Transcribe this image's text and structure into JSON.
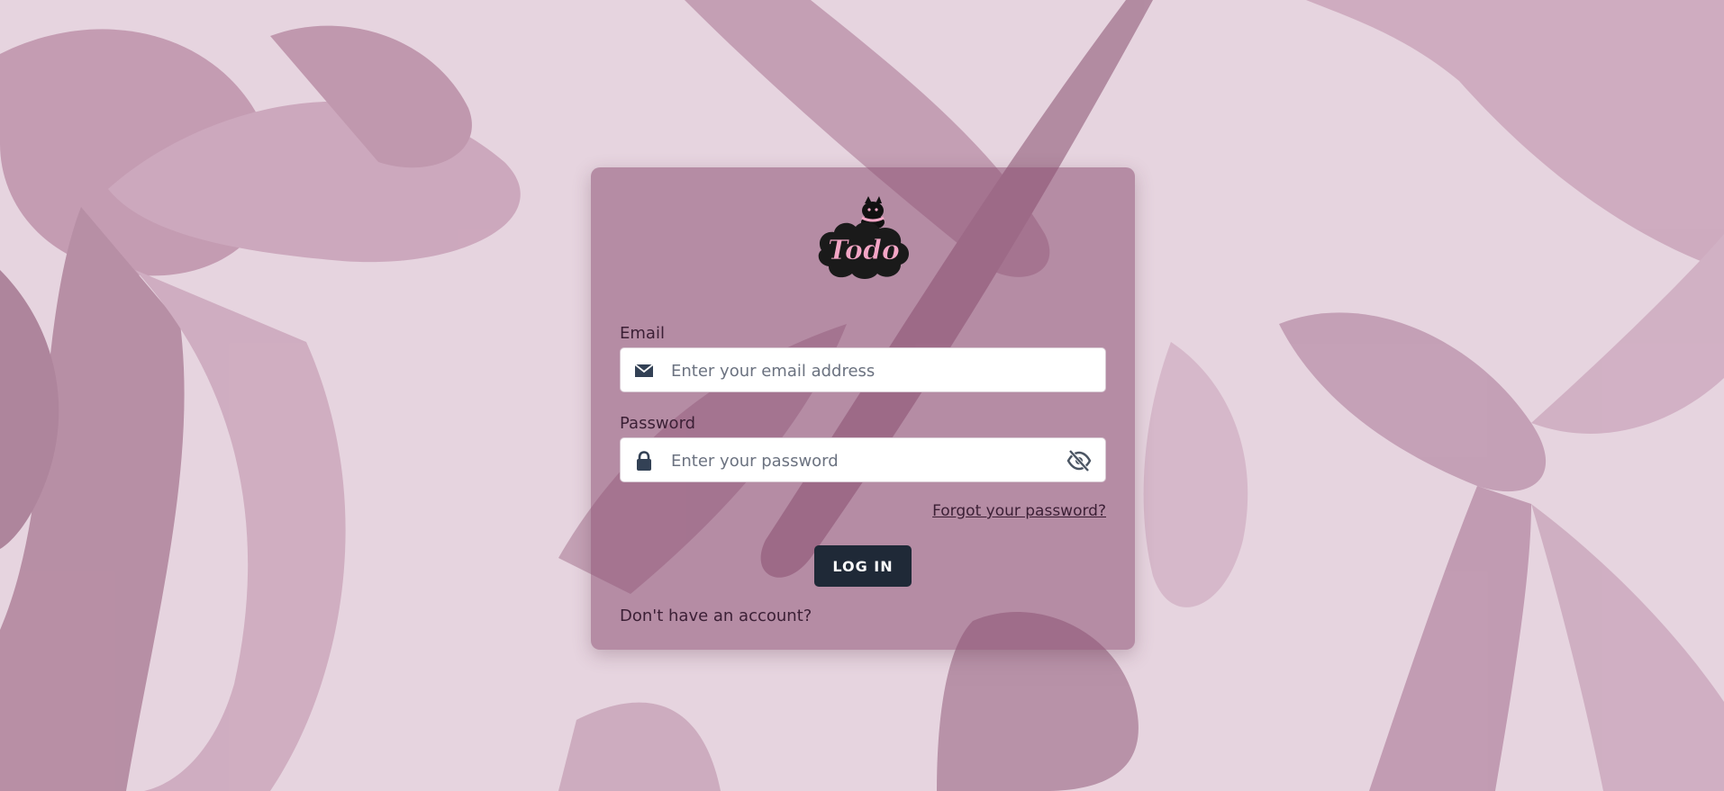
{
  "app": {
    "logo_text": "Todo"
  },
  "form": {
    "email_label": "Email",
    "email_placeholder": "Enter your email address",
    "email_value": "",
    "password_label": "Password",
    "password_placeholder": "Enter your password",
    "password_value": "",
    "forgot_link": "Forgot your password?",
    "login_button": "LOG IN",
    "signup_link": "Don't have an account?"
  },
  "icons": {
    "email": "envelope-icon",
    "password": "lock-icon",
    "toggle": "eye-slash-icon"
  },
  "colors": {
    "background": "#e5d3df",
    "card": "#a97b98",
    "button": "#1f2937",
    "logo_pink": "#f4a6c6"
  }
}
